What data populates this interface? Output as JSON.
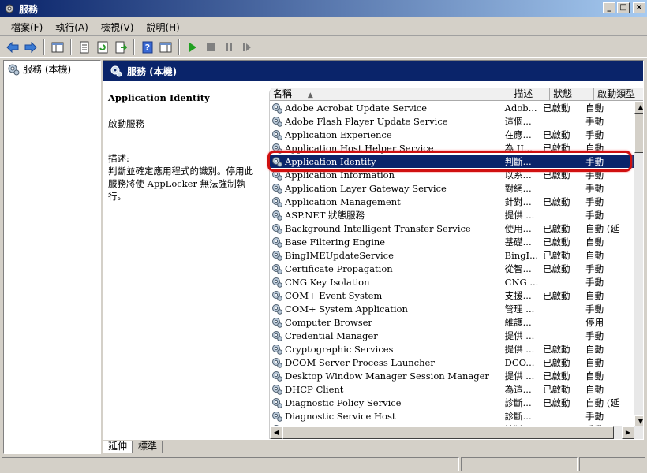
{
  "window": {
    "title": "服務"
  },
  "menu": [
    "檔案(F)",
    "執行(A)",
    "檢視(V)",
    "說明(H)"
  ],
  "tree": {
    "root_label": "服務 (本機)"
  },
  "main": {
    "header_title": "服務 (本機)"
  },
  "description": {
    "service_name": "Application Identity",
    "start_link": "啟動",
    "start_suffix": "服務",
    "desc_label": "描述:",
    "desc_text": "判斷並確定應用程式的識別。停用此服務將使 AppLocker 無法強制執行。"
  },
  "columns": [
    "名稱",
    "描述",
    "狀態",
    "啟動類型"
  ],
  "services": [
    {
      "name": "Adobe Acrobat Update Service",
      "desc": "Adob...",
      "status": "已啟動",
      "startup": "自動"
    },
    {
      "name": "Adobe Flash Player Update Service",
      "desc": "這個...",
      "status": "",
      "startup": "手動"
    },
    {
      "name": "Application Experience",
      "desc": "在應...",
      "status": "已啟動",
      "startup": "手動"
    },
    {
      "name": "Application Host Helper Service",
      "desc": "為 II...",
      "status": "已啟動",
      "startup": "自動"
    },
    {
      "name": "Application Identity",
      "desc": "判斷...",
      "status": "",
      "startup": "手動",
      "selected": true
    },
    {
      "name": "Application Information",
      "desc": "以系...",
      "status": "已啟動",
      "startup": "手動"
    },
    {
      "name": "Application Layer Gateway Service",
      "desc": "對網...",
      "status": "",
      "startup": "手動"
    },
    {
      "name": "Application Management",
      "desc": "針對...",
      "status": "已啟動",
      "startup": "手動"
    },
    {
      "name": "ASP.NET 狀態服務",
      "desc": "提供 ...",
      "status": "",
      "startup": "手動"
    },
    {
      "name": "Background Intelligent Transfer Service",
      "desc": "使用...",
      "status": "已啟動",
      "startup": "自動 (延"
    },
    {
      "name": "Base Filtering Engine",
      "desc": "基礎...",
      "status": "已啟動",
      "startup": "自動"
    },
    {
      "name": "BingIMEUpdateService",
      "desc": "BingI...",
      "status": "已啟動",
      "startup": "自動"
    },
    {
      "name": "Certificate Propagation",
      "desc": "從智...",
      "status": "已啟動",
      "startup": "手動"
    },
    {
      "name": "CNG Key Isolation",
      "desc": "CNG ...",
      "status": "",
      "startup": "手動"
    },
    {
      "name": "COM+ Event System",
      "desc": "支援...",
      "status": "已啟動",
      "startup": "自動"
    },
    {
      "name": "COM+ System Application",
      "desc": "管理 ...",
      "status": "",
      "startup": "手動"
    },
    {
      "name": "Computer Browser",
      "desc": "維護...",
      "status": "",
      "startup": "停用"
    },
    {
      "name": "Credential Manager",
      "desc": "提供 ...",
      "status": "",
      "startup": "手動"
    },
    {
      "name": "Cryptographic Services",
      "desc": "提供 ...",
      "status": "已啟動",
      "startup": "自動"
    },
    {
      "name": "DCOM Server Process Launcher",
      "desc": "DCO...",
      "status": "已啟動",
      "startup": "自動"
    },
    {
      "name": "Desktop Window Manager Session Manager",
      "desc": "提供 ...",
      "status": "已啟動",
      "startup": "自動"
    },
    {
      "name": "DHCP Client",
      "desc": "為這...",
      "status": "已啟動",
      "startup": "自動"
    },
    {
      "name": "Diagnostic Policy Service",
      "desc": "診斷...",
      "status": "已啟動",
      "startup": "自動 (延"
    },
    {
      "name": "Diagnostic Service Host",
      "desc": "診斷...",
      "status": "",
      "startup": "手動"
    },
    {
      "name": "Diagnostic System Host",
      "desc": "診斷...",
      "status": "",
      "startup": "手動"
    }
  ],
  "tabs": [
    "延伸",
    "標準"
  ]
}
